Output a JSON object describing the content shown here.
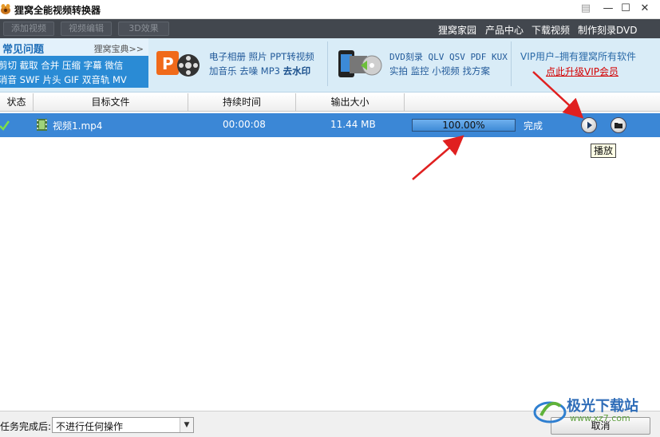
{
  "app": {
    "title": "狸窝全能视频转换器"
  },
  "window_controls": {
    "menu": "▤",
    "minimize": "—",
    "maximize": "☐",
    "close": "✕"
  },
  "toolbar": {
    "add_video": "添加视频",
    "video_edit": "视频编辑",
    "effect_3d": "3D效果",
    "links": [
      "狸窝家园",
      "产品中心",
      "下载视频",
      "制作刻录DVD"
    ]
  },
  "faq": {
    "title": "常见问题",
    "more": "狸窝宝典>>",
    "line1": "剪切 截取 合并 压缩 字幕 微信",
    "line2": "消音 SWF 片头 GIF 双音轨 MV"
  },
  "ads": {
    "ad1_line1": "电子相册 照片 PPT转视频",
    "ad1_line2_prefix": "加音乐 去噪 MP3 ",
    "ad1_line2_bold": "去水印",
    "ad2_line1": "DVD刻录 QLV QSV PDF KUX",
    "ad2_line2": "实拍 监控 小视频 找方案",
    "vip_title": "VIP用户–拥有狸窝所有软件",
    "vip_link": "点此升级VIP会员"
  },
  "table": {
    "headers": {
      "status": "状态",
      "target": "目标文件",
      "duration": "持续时间",
      "output_size": "输出大小"
    },
    "rows": [
      {
        "status_icon": "check-icon",
        "filename": "视频1.mp4",
        "duration": "00:00:08",
        "size": "11.44 MB",
        "progress_text": "100.00%",
        "progress": 1.0,
        "state": "完成"
      }
    ]
  },
  "tooltip": {
    "play": "播放"
  },
  "bottom": {
    "after_label": "任务完成后:",
    "after_value": "不进行任何操作",
    "cancel": "取消"
  },
  "watermark": {
    "text": "极光下载站",
    "url": "www.xz7.com"
  },
  "colors": {
    "toolbar_bg": "#42474e",
    "row_selected": "#3b87d6",
    "faq_bg": "#2a8bd5",
    "banner_bg": "#d9ecf7",
    "arrow": "#e02020",
    "vip_link": "#d40000"
  }
}
